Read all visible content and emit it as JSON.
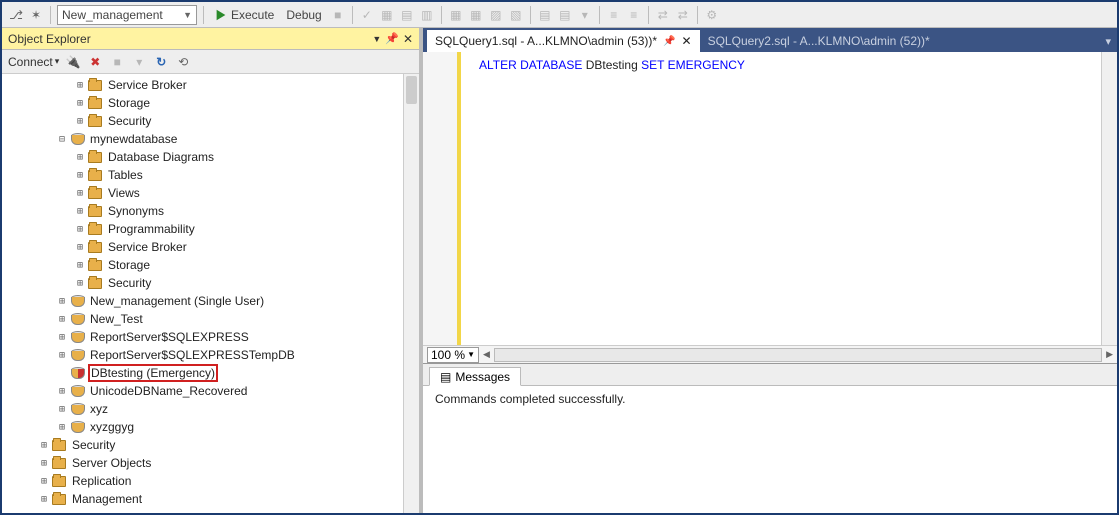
{
  "toolbar": {
    "combo_value": "New_management",
    "execute_label": "Execute",
    "debug_label": "Debug"
  },
  "object_explorer": {
    "title": "Object Explorer",
    "connect_label": "Connect"
  },
  "tree": {
    "top_nodes": [
      {
        "label": "Service Broker"
      },
      {
        "label": "Storage"
      },
      {
        "label": "Security"
      }
    ],
    "mydb_label": "mynewdatabase",
    "mydb_children": [
      {
        "label": "Database Diagrams"
      },
      {
        "label": "Tables"
      },
      {
        "label": "Views"
      },
      {
        "label": "Synonyms"
      },
      {
        "label": "Programmability"
      },
      {
        "label": "Service Broker"
      },
      {
        "label": "Storage"
      },
      {
        "label": "Security"
      }
    ],
    "db_nodes": [
      {
        "label": "New_management (Single User)"
      },
      {
        "label": "New_Test"
      },
      {
        "label": "ReportServer$SQLEXPRESS"
      },
      {
        "label": "ReportServer$SQLEXPRESSTempDB"
      }
    ],
    "emergency_label": "DBtesting (Emergency)",
    "db_nodes2": [
      {
        "label": "UnicodeDBName_Recovered"
      },
      {
        "label": "xyz"
      },
      {
        "label": "xyzggyg"
      }
    ],
    "root_folders": [
      {
        "label": "Security"
      },
      {
        "label": "Server Objects"
      },
      {
        "label": "Replication"
      },
      {
        "label": "Management"
      }
    ]
  },
  "tabs": {
    "active": "SQLQuery1.sql - A...KLMNO\\admin (53))*",
    "inactive": "SQLQuery2.sql - A...KLMNO\\admin (52))*"
  },
  "sql": {
    "kw1": "ALTER",
    "kw2": "DATABASE",
    "ident": "DBtesting",
    "kw3": "SET",
    "kw4": "EMERGENCY"
  },
  "zoom": "100 %",
  "messages": {
    "tab_label": "Messages",
    "body": "Commands completed successfully."
  }
}
